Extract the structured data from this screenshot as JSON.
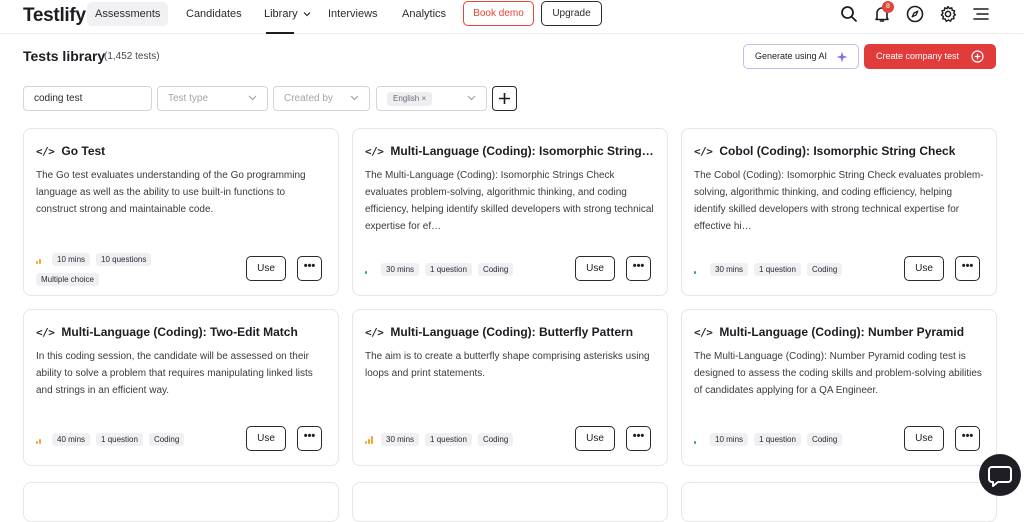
{
  "header": {
    "logo": "Testlify",
    "nav": [
      "Assessments",
      "Candidates",
      "Library",
      "Interviews",
      "Analytics"
    ],
    "book_demo": "Book demo",
    "upgrade": "Upgrade",
    "notification_count": "8"
  },
  "page": {
    "title": "Tests library",
    "count": "(1,452 tests)",
    "generate_ai": "Generate using AI",
    "create_test": "Create company test"
  },
  "filters": {
    "search_value": "coding test",
    "test_type_placeholder": "Test type",
    "created_by_placeholder": "Created by",
    "language_chip": "English ×"
  },
  "cards": [
    {
      "title": "Go Test",
      "desc": "The Go test evaluates understanding of the Go programming language as well as the ability to use built-in functions to construct strong and maintainable code.",
      "tags": [
        "10 mins",
        "10 questions"
      ],
      "tags2": [
        "Multiple choice"
      ],
      "use": "Use",
      "more": "•••",
      "level": "medium"
    },
    {
      "title": "Multi-Language (Coding): Isomorphic String…",
      "desc": "The Multi-Language (Coding): Isomorphic Strings Check evaluates problem-solving, algorithmic thinking, and coding efficiency, helping identify skilled developers with strong technical expertise for ef…",
      "tags": [
        "30 mins",
        "1 question",
        "Coding"
      ],
      "use": "Use",
      "more": "•••",
      "level": "easy"
    },
    {
      "title": "Cobol (Coding): Isomorphic String Check",
      "desc": "The Cobol (Coding): Isomorphic String Check evaluates problem-solving, algorithmic thinking, and coding efficiency, helping identify skilled developers with strong technical expertise for effective hi…",
      "tags": [
        "30 mins",
        "1 question",
        "Coding"
      ],
      "use": "Use",
      "more": "•••",
      "level": "easy"
    },
    {
      "title": "Multi-Language (Coding): Two-Edit Match",
      "desc": "In this coding session, the candidate will be assessed on their ability to solve a problem that requires manipulating linked lists and strings in an efficient way.",
      "tags": [
        "40 mins",
        "1 question",
        "Coding"
      ],
      "use": "Use",
      "more": "•••",
      "level": "medium"
    },
    {
      "title": "Multi-Language (Coding): Butterfly Pattern",
      "desc": "The aim is to create a butterfly shape comprising asterisks using loops and print statements.",
      "tags": [
        "30 mins",
        "1 question",
        "Coding"
      ],
      "use": "Use",
      "more": "•••",
      "level": "hard"
    },
    {
      "title": "Multi-Language (Coding): Number Pyramid",
      "desc": "The Multi-Language (Coding): Number Pyramid coding test is designed to assess the coding skills and problem-solving abilities of candidates applying for a QA Engineer.",
      "tags": [
        "10 mins",
        "1 question",
        "Coding"
      ],
      "use": "Use",
      "more": "•••",
      "level": "easy"
    }
  ],
  "colors": {
    "accent": "#e23b3b",
    "easy": "#2fa36b",
    "medium": "#f2a52e",
    "hard": "#f2a52e"
  }
}
